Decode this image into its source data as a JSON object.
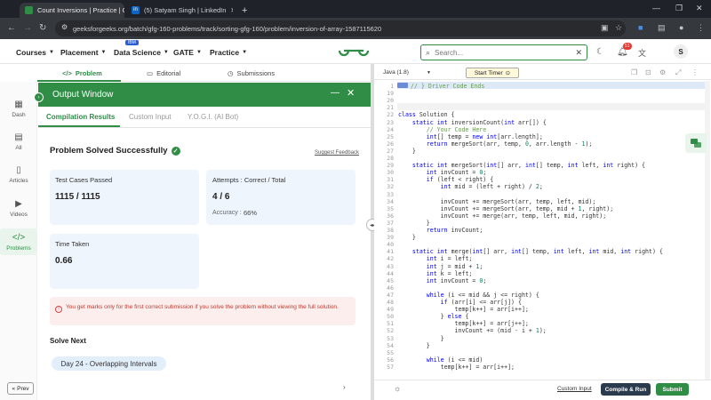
{
  "browser": {
    "tabs": [
      {
        "title": "Count Inversions | Practice | Ge",
        "active": true,
        "favicon_color": "#2f8d46"
      },
      {
        "title": "(5) Satyam Singh | LinkedIn",
        "active": false,
        "favicon_color": "#0a66c2"
      }
    ],
    "new_tab": "+",
    "url": "geeksforgeeks.org/batch/gfg-160-problems/track/sorting-gfg-160/problem/inversion-of-array-1587115620"
  },
  "site": {
    "menu": [
      {
        "label": "Courses"
      },
      {
        "label": "Placement"
      },
      {
        "label": "Data Science"
      },
      {
        "label": "GATE"
      },
      {
        "label": "Practice"
      }
    ],
    "ibm_badge": "IBM",
    "search_placeholder": "Search...",
    "notif_count": "51",
    "avatar_letter": "S",
    "accent": "#2f8d46"
  },
  "problem_tabs": [
    {
      "label": "Problem"
    },
    {
      "label": "Editorial"
    },
    {
      "label": "Submissions"
    }
  ],
  "rail": [
    {
      "label": "Dash"
    },
    {
      "label": "All"
    },
    {
      "label": "Articles"
    },
    {
      "label": "Videos"
    },
    {
      "label": "Problems"
    }
  ],
  "prev_label": "Prev",
  "output": {
    "title": "Output Window",
    "tabs": [
      "Compilation Results",
      "Custom Input",
      "Y.O.G.I. (AI Bot)"
    ],
    "status": "Problem Solved Successfully",
    "feedback": "Suggest Feedback",
    "test_cases_label": "Test Cases Passed",
    "test_cases_value": "1115 / 1115",
    "attempts_label": "Attempts : Correct / Total",
    "attempts_value": "4 / 6",
    "accuracy_label": "Accuracy :",
    "accuracy_value": "66%",
    "time_label": "Time Taken",
    "time_value": "0.66",
    "warning": "You get marks only for the first correct submission if you solve the problem without viewing the full solution.",
    "solve_next": "Solve Next",
    "next_problem": "Day 24 - Overlapping Intervals"
  },
  "editor": {
    "language": "Java (1.8)",
    "timer": "Start Timer",
    "custom_input": "Custom Input",
    "compile_run": "Compile & Run",
    "submit": "Submit",
    "lines": [
      {
        "n": "1",
        "t": "// } Driver Code Ends"
      },
      {
        "n": "19",
        "t": ""
      },
      {
        "n": "20",
        "t": ""
      },
      {
        "n": "21",
        "t": ""
      },
      {
        "n": "22",
        "t": "class Solution {"
      },
      {
        "n": "23",
        "t": "    static int inversionCount(int arr[]) {"
      },
      {
        "n": "24",
        "t": "        // Your Code Here"
      },
      {
        "n": "25",
        "t": "        int[] temp = new int[arr.length];"
      },
      {
        "n": "26",
        "t": "        return mergeSort(arr, temp, 0, arr.length - 1);"
      },
      {
        "n": "27",
        "t": "    }"
      },
      {
        "n": "28",
        "t": ""
      },
      {
        "n": "29",
        "t": "    static int mergeSort(int[] arr, int[] temp, int left, int right) {"
      },
      {
        "n": "30",
        "t": "        int invCount = 0;"
      },
      {
        "n": "31",
        "t": "        if (left < right) {"
      },
      {
        "n": "32",
        "t": "            int mid = (left + right) / 2;"
      },
      {
        "n": "33",
        "t": ""
      },
      {
        "n": "34",
        "t": "            invCount += mergeSort(arr, temp, left, mid);"
      },
      {
        "n": "35",
        "t": "            invCount += mergeSort(arr, temp, mid + 1, right);"
      },
      {
        "n": "36",
        "t": "            invCount += merge(arr, temp, left, mid, right);"
      },
      {
        "n": "37",
        "t": "        }"
      },
      {
        "n": "38",
        "t": "        return invCount;"
      },
      {
        "n": "39",
        "t": "    }"
      },
      {
        "n": "40",
        "t": ""
      },
      {
        "n": "41",
        "t": "    static int merge(int[] arr, int[] temp, int left, int mid, int right) {"
      },
      {
        "n": "42",
        "t": "        int i = left;"
      },
      {
        "n": "43",
        "t": "        int j = mid + 1;"
      },
      {
        "n": "44",
        "t": "        int k = left;"
      },
      {
        "n": "45",
        "t": "        int invCount = 0;"
      },
      {
        "n": "46",
        "t": ""
      },
      {
        "n": "47",
        "t": "        while (i <= mid && j <= right) {"
      },
      {
        "n": "48",
        "t": "            if (arr[i] <= arr[j]) {"
      },
      {
        "n": "49",
        "t": "                temp[k++] = arr[i++];"
      },
      {
        "n": "50",
        "t": "            } else {"
      },
      {
        "n": "51",
        "t": "                temp[k++] = arr[j++];"
      },
      {
        "n": "52",
        "t": "                invCount += (mid - i + 1);"
      },
      {
        "n": "53",
        "t": "            }"
      },
      {
        "n": "54",
        "t": "        }"
      },
      {
        "n": "55",
        "t": ""
      },
      {
        "n": "56",
        "t": "        while (i <= mid)"
      },
      {
        "n": "57",
        "t": "            temp[k++] = arr[i++];"
      }
    ]
  }
}
